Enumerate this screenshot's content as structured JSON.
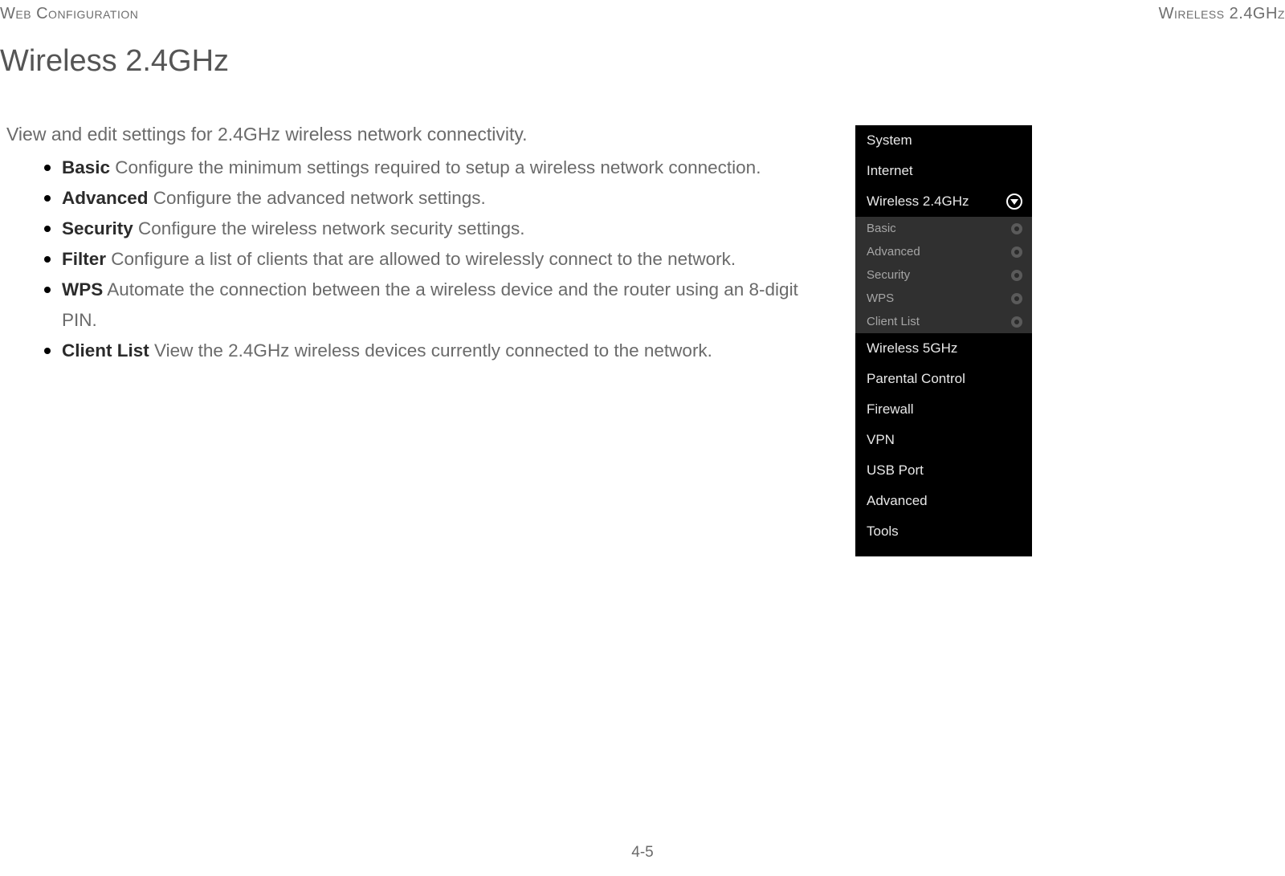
{
  "header": {
    "left": "Web Configuration",
    "right": "Wireless 2.4GHz"
  },
  "title": "Wireless 2.4GHz",
  "intro": "View and edit settings for 2.4GHz wireless network connectivity.",
  "bullets": [
    {
      "term": "Basic",
      "desc": "  Configure the minimum settings required to setup a wireless network connection."
    },
    {
      "term": "Advanced",
      "desc": "  Configure the advanced network settings."
    },
    {
      "term": "Security",
      "desc": "  Configure the wireless network security settings."
    },
    {
      "term": "Filter",
      "desc": "  Configure a list of clients that are allowed to wirelessly connect to the network."
    },
    {
      "term": "WPS",
      "desc": "  Automate the connection between the a wireless device and the router using an 8-digit PIN."
    },
    {
      "term": "Client List",
      "desc": "  View the 2.4GHz wireless devices currently connected to the network."
    }
  ],
  "sidebar": {
    "items": [
      {
        "label": "System",
        "expanded": false
      },
      {
        "label": "Internet",
        "expanded": false
      },
      {
        "label": "Wireless 2.4GHz",
        "expanded": true,
        "sub": [
          {
            "label": "Basic"
          },
          {
            "label": "Advanced"
          },
          {
            "label": "Security"
          },
          {
            "label": "WPS"
          },
          {
            "label": "Client List"
          }
        ]
      },
      {
        "label": "Wireless 5GHz",
        "expanded": false
      },
      {
        "label": "Parental Control",
        "expanded": false
      },
      {
        "label": "Firewall",
        "expanded": false
      },
      {
        "label": "VPN",
        "expanded": false
      },
      {
        "label": "USB Port",
        "expanded": false
      },
      {
        "label": "Advanced",
        "expanded": false
      },
      {
        "label": "Tools",
        "expanded": false
      }
    ]
  },
  "page_number": "4-5"
}
